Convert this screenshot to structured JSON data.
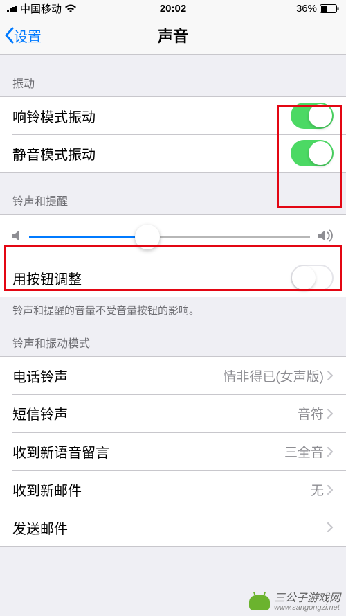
{
  "status": {
    "carrier": "中国移动",
    "time": "20:02",
    "battery_pct": "36%"
  },
  "nav": {
    "back_label": "设置",
    "title": "声音"
  },
  "sections": {
    "vibration": {
      "header": "振动",
      "ring_vibrate": {
        "label": "响铃模式振动",
        "on": true
      },
      "silent_vibrate": {
        "label": "静音模式振动",
        "on": true
      }
    },
    "ringer": {
      "header": "铃声和提醒",
      "volume_pct": 42,
      "button_adjust": {
        "label": "用按钮调整",
        "on": false
      },
      "footer": "铃声和提醒的音量不受音量按钮的影响。"
    },
    "patterns": {
      "header": "铃声和振动模式",
      "items": [
        {
          "label": "电话铃声",
          "value": "情非得已(女声版)"
        },
        {
          "label": "短信铃声",
          "value": "音符"
        },
        {
          "label": "收到新语音留言",
          "value": "三全音"
        },
        {
          "label": "收到新邮件",
          "value": "无"
        },
        {
          "label": "发送邮件",
          "value": ""
        }
      ]
    }
  },
  "watermark": {
    "text": "三公子游戏网",
    "url": "www.sangongzi.net"
  }
}
